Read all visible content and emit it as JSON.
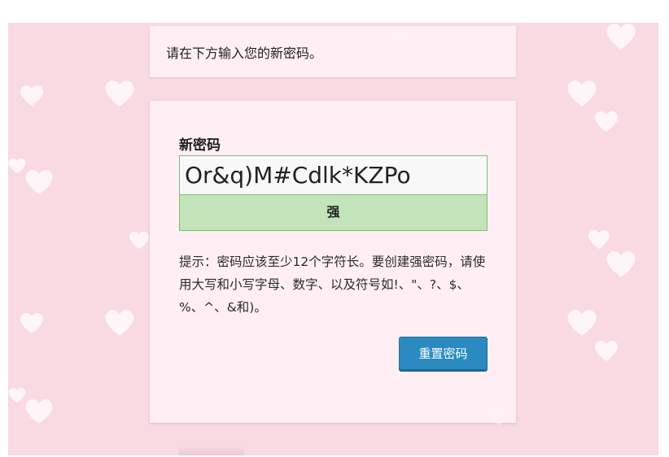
{
  "notice": {
    "message": "请在下方输入您的新密码。"
  },
  "form": {
    "label": "新密码",
    "password_value": "Or&q)M#Cdlk*KZPo",
    "strength_text": "强",
    "hint_text": "提示：密码应该至少12个字符长。要创建强密码，请使用大写和小写字母、数字、以及符号如!、\"、?、$、%、^、&和)。",
    "submit_label": "重置密码"
  },
  "colors": {
    "background": "#f9d9e2",
    "strength_good": "#c3e3bb",
    "strength_border": "#7fbf6a",
    "button": "#2b8bc1"
  },
  "icons": {
    "decoration": "heart-icon"
  }
}
